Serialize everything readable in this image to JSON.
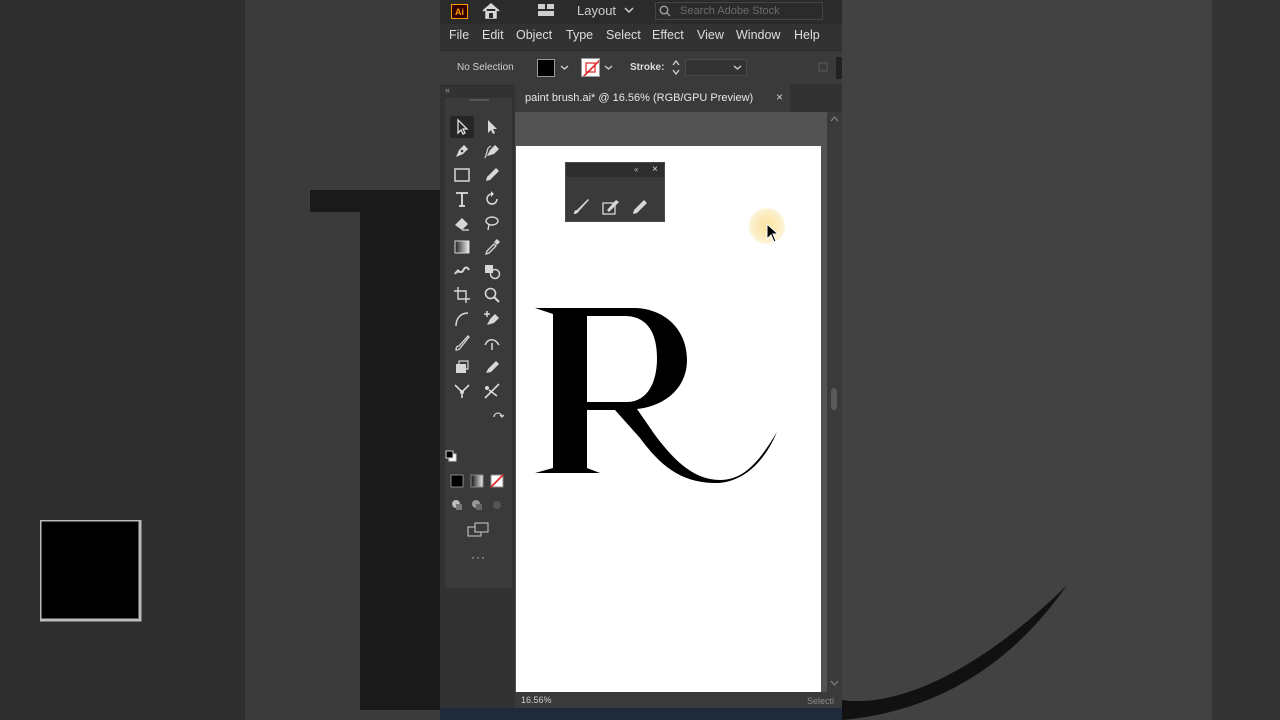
{
  "app": {
    "logo": "Ai",
    "workspace": "Layout",
    "stock_search_placeholder": "Search Adobe Stock"
  },
  "menu": [
    "File",
    "Edit",
    "Object",
    "Type",
    "Select",
    "Effect",
    "View",
    "Window",
    "Help"
  ],
  "control_bar": {
    "selection_status": "No Selection",
    "fill_color": "#000000",
    "stroke_color": "none",
    "stroke_label": "Stroke:",
    "stroke_value": ""
  },
  "document": {
    "tab_title": "paint brush.ai* @ 16.56% (RGB/GPU Preview)",
    "close": "×",
    "zoom": "16.56%",
    "status_tool": "Selecti"
  },
  "toolbar": {
    "collapse": "«",
    "tools": [
      "selection-tool",
      "direct-selection-tool",
      "pen-tool",
      "curvature-tool",
      "rectangle-tool",
      "pencil-tool",
      "type-tool",
      "rotate-tool",
      "eraser-tool",
      "lasso-tool",
      "gradient-tool",
      "eyedropper-tool",
      "puppet-warp-tool",
      "shape-builder-tool",
      "artboard-tool",
      "zoom-tool",
      "arc-tool",
      "add-anchor-tool",
      "paintbrush-tool",
      "width-tool",
      "free-transform-tool",
      "blob-brush-tool",
      "symbol-sprayer-tool",
      "scissors-tool"
    ],
    "more": "···"
  },
  "floating_panel": {
    "collapse": "«",
    "close": "×",
    "tools": [
      "paintbrush-icon",
      "blob-brush-icon",
      "pencil-icon"
    ]
  },
  "colors": {
    "accent": "#ff9a00",
    "panel": "#323232",
    "artboard": "#ffffff"
  }
}
